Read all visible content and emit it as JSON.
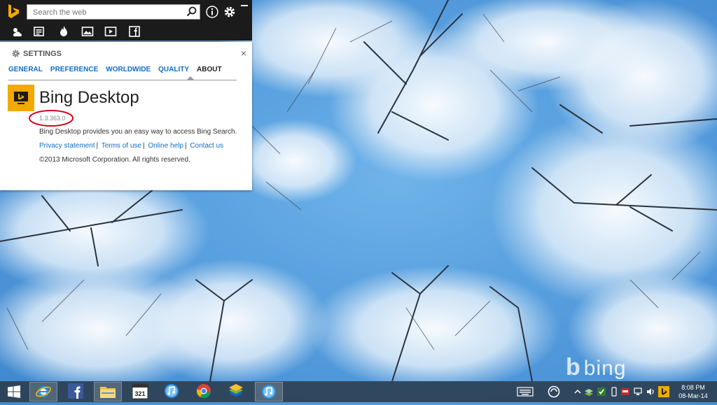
{
  "toolbar": {
    "search_placeholder": "Search the web",
    "icons": [
      "weather-icon",
      "news-icon",
      "trending-icon",
      "images-icon",
      "videos-icon",
      "facebook-icon"
    ]
  },
  "settings": {
    "heading": "SETTINGS",
    "close": "×",
    "tabs": [
      "GENERAL",
      "PREFERENCE",
      "WORLDWIDE",
      "QUALITY",
      "ABOUT"
    ],
    "active_tab": "ABOUT",
    "app_name": "Bing Desktop",
    "version": "1.3.363.0",
    "description": "Bing Desktop provides you an easy way to access Bing Search.",
    "links": [
      "Privacy statement",
      "Terms of use",
      "Online help",
      "Contact us"
    ],
    "copyright": "©2013 Microsoft Corporation. All rights reserved."
  },
  "desktop": {
    "watermark": "bing"
  },
  "taskbar": {
    "apps": [
      "start-button",
      "internet-explorer-icon",
      "facebook-icon",
      "file-explorer-icon",
      "calendar-icon",
      "itunes-icon",
      "chrome-icon",
      "bluestacks-icon",
      "itunes-icon"
    ],
    "calendar_number": "321",
    "clock_time": "8:08 PM",
    "clock_date": "08-Mar-14"
  },
  "colors": {
    "accent_link": "#0f6fc6",
    "bing_yellow": "#f2a900",
    "annotation_red": "#d9001b"
  }
}
